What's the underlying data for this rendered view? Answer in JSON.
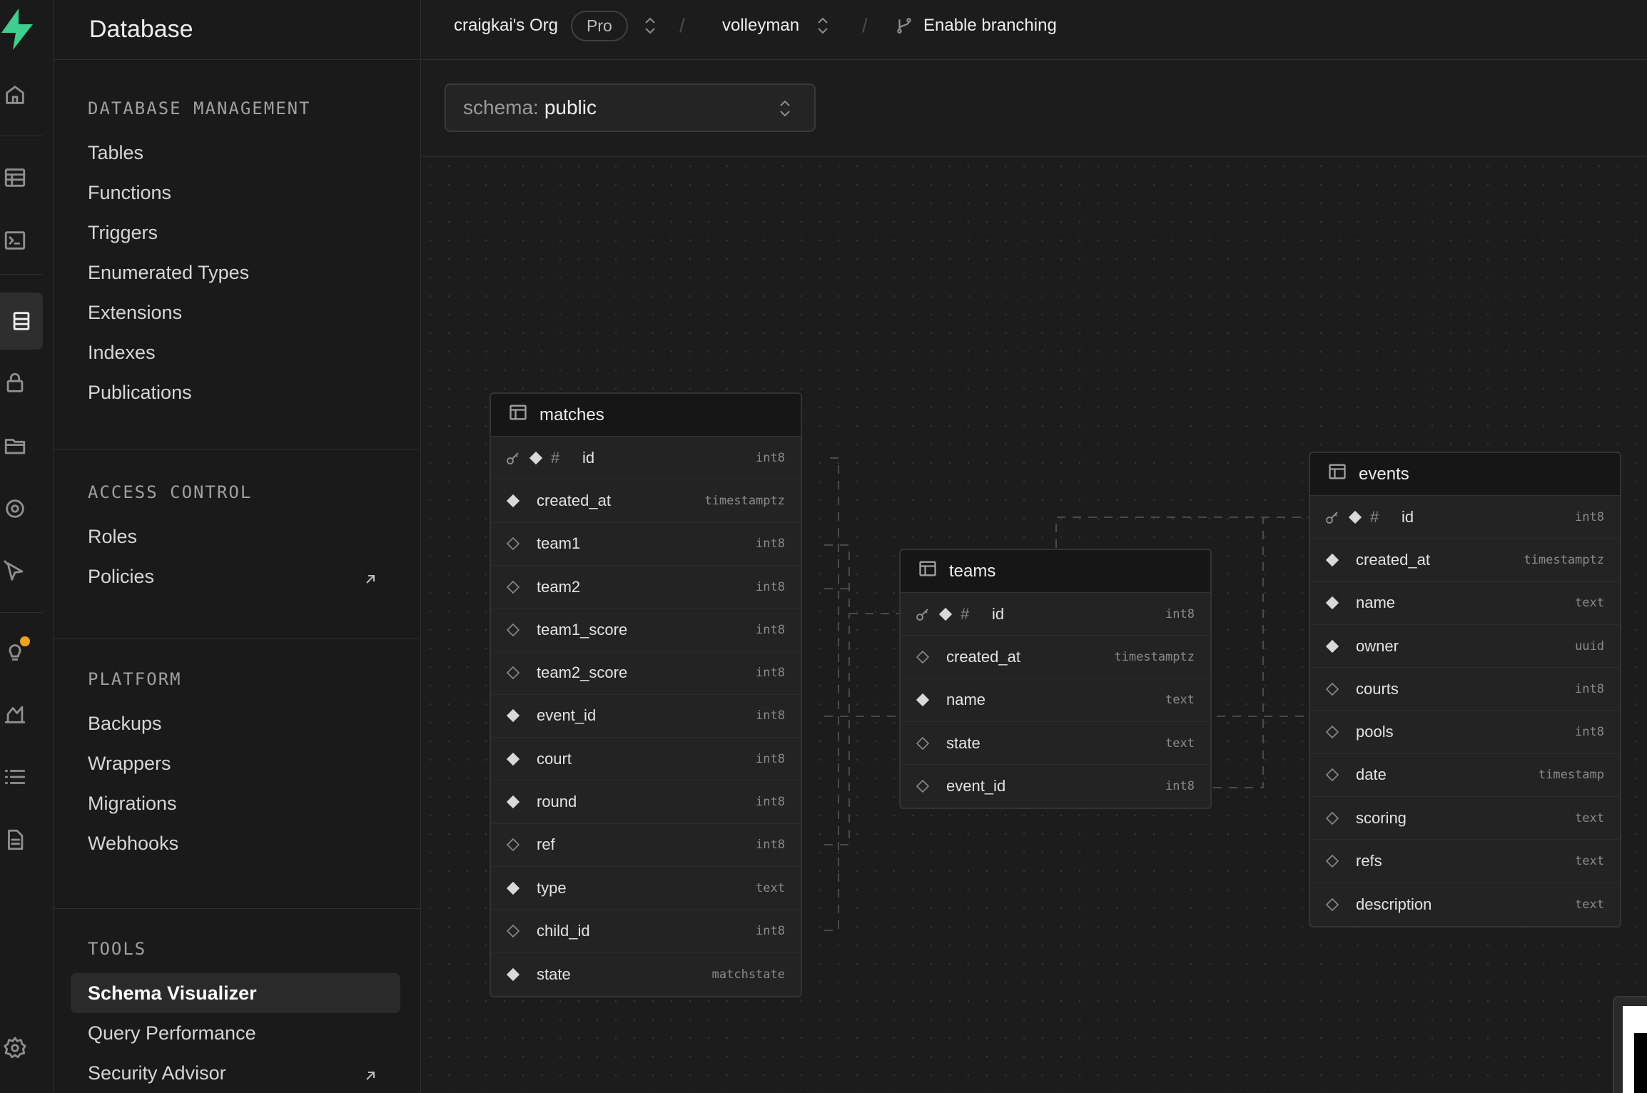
{
  "app": {
    "section_title": "Database",
    "org": "craigkai's Org",
    "plan": "Pro",
    "project": "volleyman",
    "branching": "Enable branching"
  },
  "schema_select": {
    "label": "schema:",
    "value": "public"
  },
  "sidenav": {
    "sections": [
      {
        "title": "DATABASE MANAGEMENT",
        "items": [
          "Tables",
          "Functions",
          "Triggers",
          "Enumerated Types",
          "Extensions",
          "Indexes",
          "Publications"
        ]
      },
      {
        "title": "ACCESS CONTROL",
        "items": [
          "Roles",
          "Policies"
        ]
      },
      {
        "title": "PLATFORM",
        "items": [
          "Backups",
          "Wrappers",
          "Migrations",
          "Webhooks"
        ]
      },
      {
        "title": "TOOLS",
        "items": [
          "Schema Visualizer",
          "Query Performance",
          "Security Advisor"
        ]
      }
    ]
  },
  "tables": {
    "matches": {
      "name": "matches",
      "columns": [
        {
          "name": "id",
          "type": "int8",
          "pk": true,
          "nullable": false
        },
        {
          "name": "created_at",
          "type": "timestamptz",
          "nullable": false
        },
        {
          "name": "team1",
          "type": "int8",
          "nullable": true
        },
        {
          "name": "team2",
          "type": "int8",
          "nullable": true
        },
        {
          "name": "team1_score",
          "type": "int8",
          "nullable": true
        },
        {
          "name": "team2_score",
          "type": "int8",
          "nullable": true
        },
        {
          "name": "event_id",
          "type": "int8",
          "nullable": false
        },
        {
          "name": "court",
          "type": "int8",
          "nullable": false
        },
        {
          "name": "round",
          "type": "int8",
          "nullable": false
        },
        {
          "name": "ref",
          "type": "int8",
          "nullable": true
        },
        {
          "name": "type",
          "type": "text",
          "nullable": false
        },
        {
          "name": "child_id",
          "type": "int8",
          "nullable": true
        },
        {
          "name": "state",
          "type": "matchstate",
          "nullable": false
        }
      ]
    },
    "teams": {
      "name": "teams",
      "columns": [
        {
          "name": "id",
          "type": "int8",
          "pk": true,
          "nullable": false
        },
        {
          "name": "created_at",
          "type": "timestamptz",
          "nullable": true
        },
        {
          "name": "name",
          "type": "text",
          "nullable": false
        },
        {
          "name": "state",
          "type": "text",
          "nullable": true
        },
        {
          "name": "event_id",
          "type": "int8",
          "nullable": true
        }
      ]
    },
    "events": {
      "name": "events",
      "columns": [
        {
          "name": "id",
          "type": "int8",
          "pk": true,
          "nullable": false
        },
        {
          "name": "created_at",
          "type": "timestamptz",
          "nullable": false
        },
        {
          "name": "name",
          "type": "text",
          "nullable": false
        },
        {
          "name": "owner",
          "type": "uuid",
          "nullable": false
        },
        {
          "name": "courts",
          "type": "int8",
          "nullable": true
        },
        {
          "name": "pools",
          "type": "int8",
          "nullable": true
        },
        {
          "name": "date",
          "type": "timestamp",
          "nullable": true
        },
        {
          "name": "scoring",
          "type": "text",
          "nullable": true
        },
        {
          "name": "refs",
          "type": "text",
          "nullable": true
        },
        {
          "name": "description",
          "type": "text",
          "nullable": true
        }
      ]
    }
  },
  "icons": {
    "rail": [
      "home-icon",
      "table-editor-icon",
      "sql-editor-icon",
      "database-icon",
      "auth-icon",
      "storage-icon",
      "realtime-icon",
      "edge-functions-icon",
      "advisors-icon",
      "reports-icon",
      "logs-icon",
      "docs-icon",
      "settings-icon"
    ]
  },
  "colors": {
    "accent": "#3ecf8e",
    "notification": "#f0a31b",
    "background": "#1c1c1c"
  }
}
